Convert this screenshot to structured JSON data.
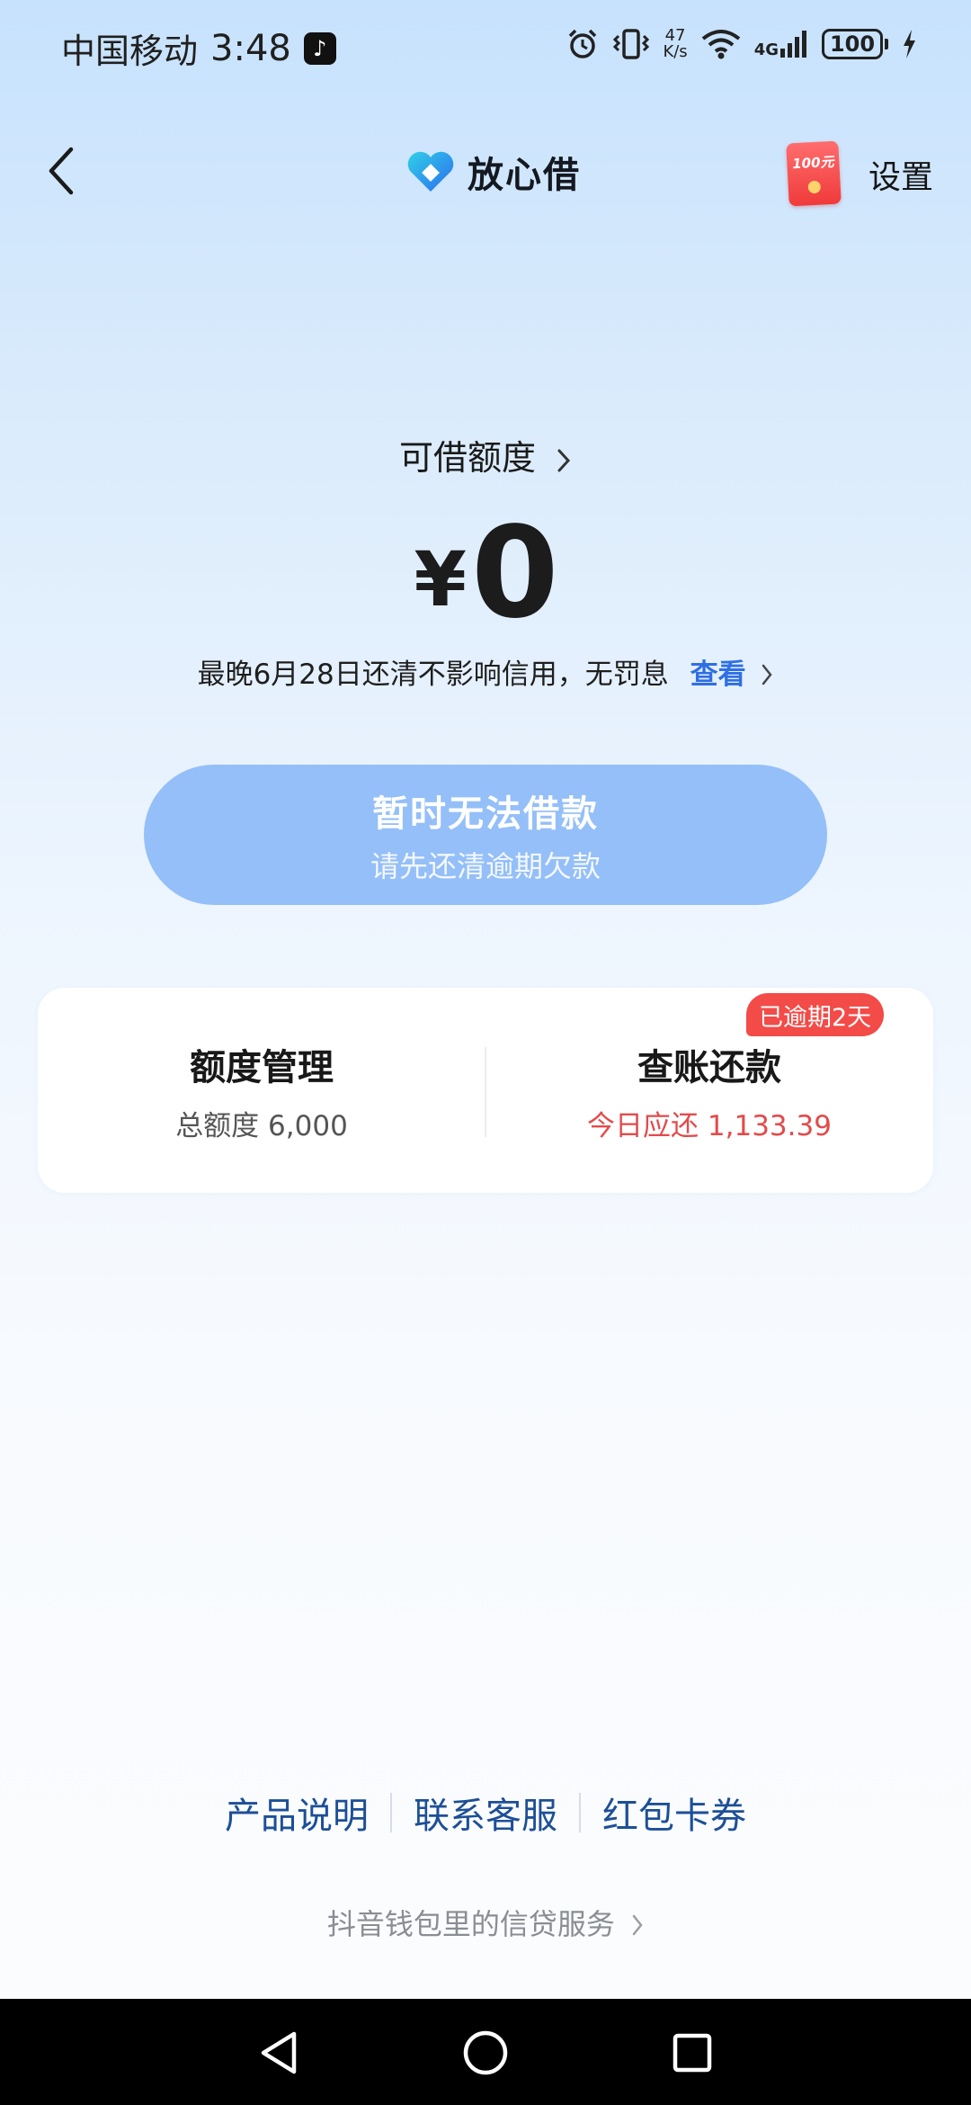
{
  "status_bar": {
    "carrier": "中国移动",
    "time": "3:48",
    "net_speed_value": "47",
    "net_speed_unit": "K/s",
    "network": "4G",
    "battery": "100",
    "icons": [
      "tiktok-icon",
      "alarm-icon",
      "vibrate-icon",
      "wifi-icon",
      "signal-icon",
      "charging-icon"
    ]
  },
  "header": {
    "app_name": "放心借",
    "redpacket_label": "100元",
    "settings_label": "设置"
  },
  "credit": {
    "title": "可借额度",
    "currency": "¥",
    "amount": "0",
    "notice": "最晚6月28日还清不影响信用，无罚息",
    "view_label": "查看"
  },
  "borrow_button": {
    "title": "暂时无法借款",
    "subtitle": "请先还清逾期欠款",
    "color": "#94bff8"
  },
  "card": {
    "left": {
      "title": "额度管理",
      "subtitle": "总额度 6,000"
    },
    "right": {
      "title": "查账还款",
      "subtitle": "今日应还 1,133.39",
      "badge": "已逾期2天"
    }
  },
  "footer": {
    "links": [
      "产品说明",
      "联系客服",
      "红包卡券"
    ],
    "service_note": "抖音钱包里的信贷服务"
  },
  "colors": {
    "accent": "#2f6fe4",
    "link": "#1d4f97",
    "danger": "#e24b4b",
    "badge": "#f34b47"
  }
}
